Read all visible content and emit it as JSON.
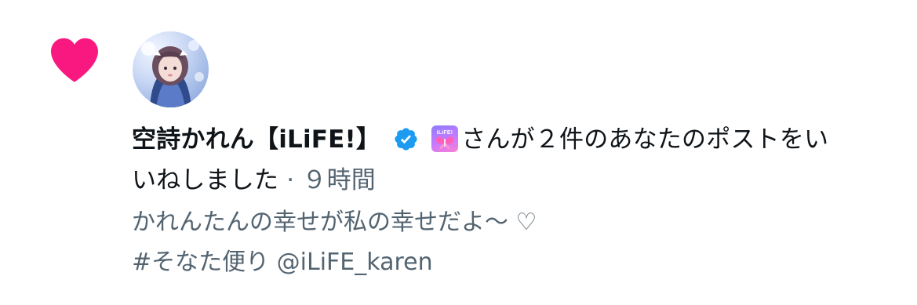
{
  "notification": {
    "type_icon": "heart-icon",
    "type_icon_color": "#f91880",
    "avatar_icon": "user-avatar",
    "user_name": "空詩かれん【iLiFE!】",
    "verified_icon": "verified-badge-icon",
    "verified_color": "#1d9bf0",
    "affiliate_icon": "ilife-affiliate-badge-icon",
    "affiliate_badge_text": "iLiFE!",
    "action_text_line1": "さんが２件のあなたのポストをい",
    "action_text_line2": "いねしました",
    "separator": " · ",
    "timestamp": "９時間",
    "tweet_line1": "かれんたんの幸せが私の幸せだよ～ ♡",
    "tweet_line2": "#そなた便り @iLiFE_karen"
  }
}
